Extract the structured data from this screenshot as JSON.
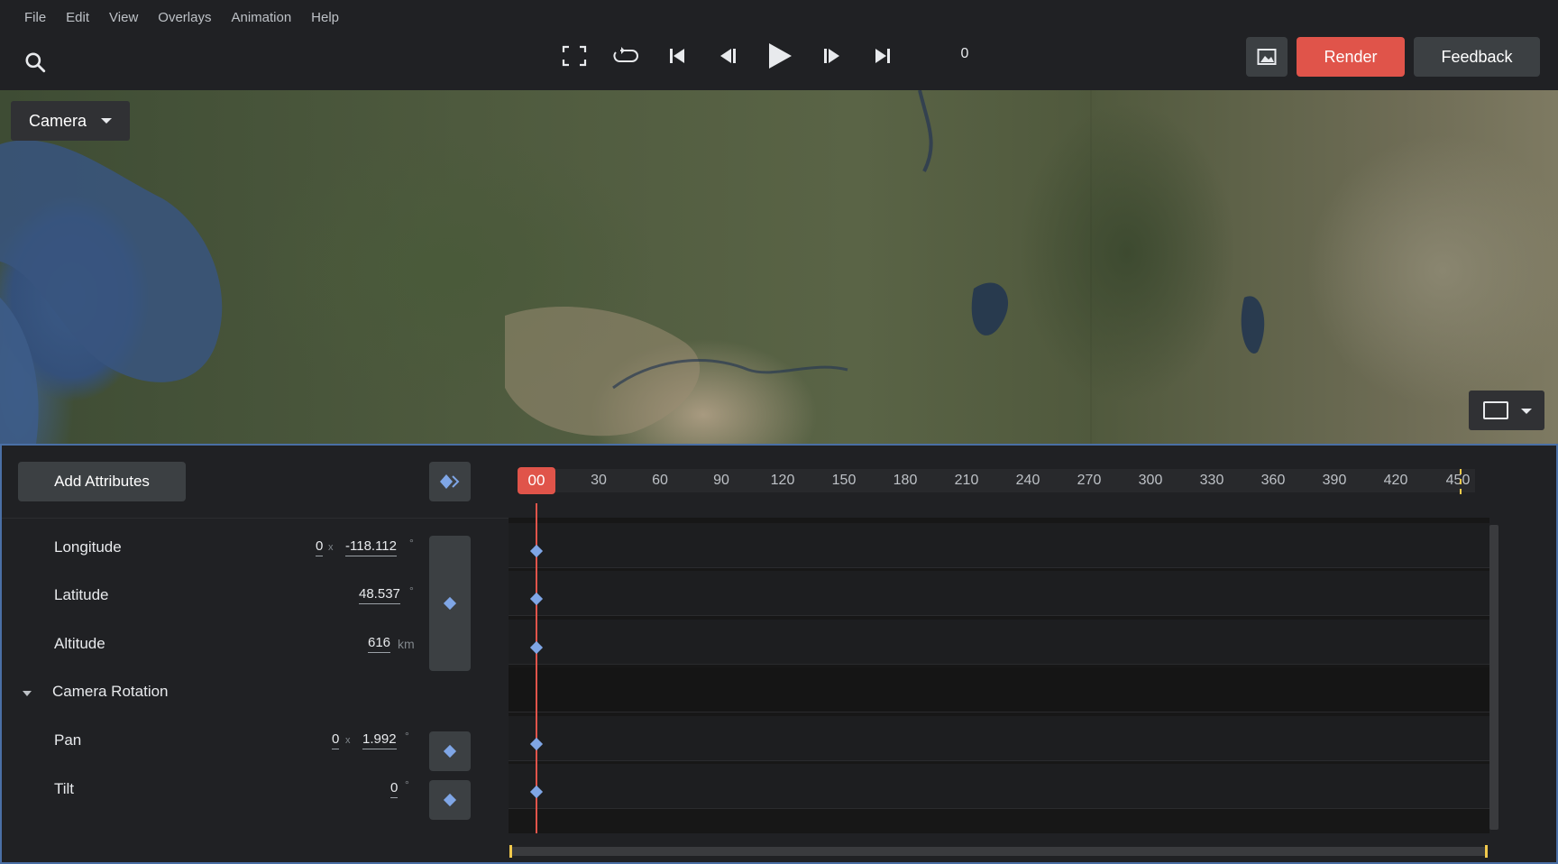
{
  "menu": [
    "File",
    "Edit",
    "View",
    "Overlays",
    "Animation",
    "Help"
  ],
  "toolbar": {
    "frame": "0",
    "render_label": "Render",
    "feedback_label": "Feedback"
  },
  "viewport": {
    "camera_label": "Camera"
  },
  "panel": {
    "add_attributes_label": "Add Attributes",
    "playhead_label": "00",
    "ruler_ticks": [
      "30",
      "60",
      "90",
      "120",
      "150",
      "180",
      "210",
      "240",
      "270",
      "300",
      "330",
      "360",
      "390",
      "420",
      "450"
    ]
  },
  "attributes": {
    "longitude": {
      "label": "Longitude",
      "rotations": "0",
      "rotations_unit": "x",
      "value": "-118.112",
      "unit": "°"
    },
    "latitude": {
      "label": "Latitude",
      "value": "48.537",
      "unit": "°"
    },
    "altitude": {
      "label": "Altitude",
      "value": "616",
      "unit": "km"
    },
    "camera_rotation": {
      "label": "Camera Rotation"
    },
    "pan": {
      "label": "Pan",
      "rotations": "0",
      "rotations_unit": "x",
      "value": "1.992",
      "unit": "°"
    },
    "tilt": {
      "label": "Tilt",
      "value": "0",
      "unit": "°"
    }
  },
  "colors": {
    "accent_red": "#e0544a",
    "keyframe_blue": "#7fa6e6",
    "range_marker_yellow": "#f2c94c",
    "panel_border_blue": "#4a6fa5"
  }
}
